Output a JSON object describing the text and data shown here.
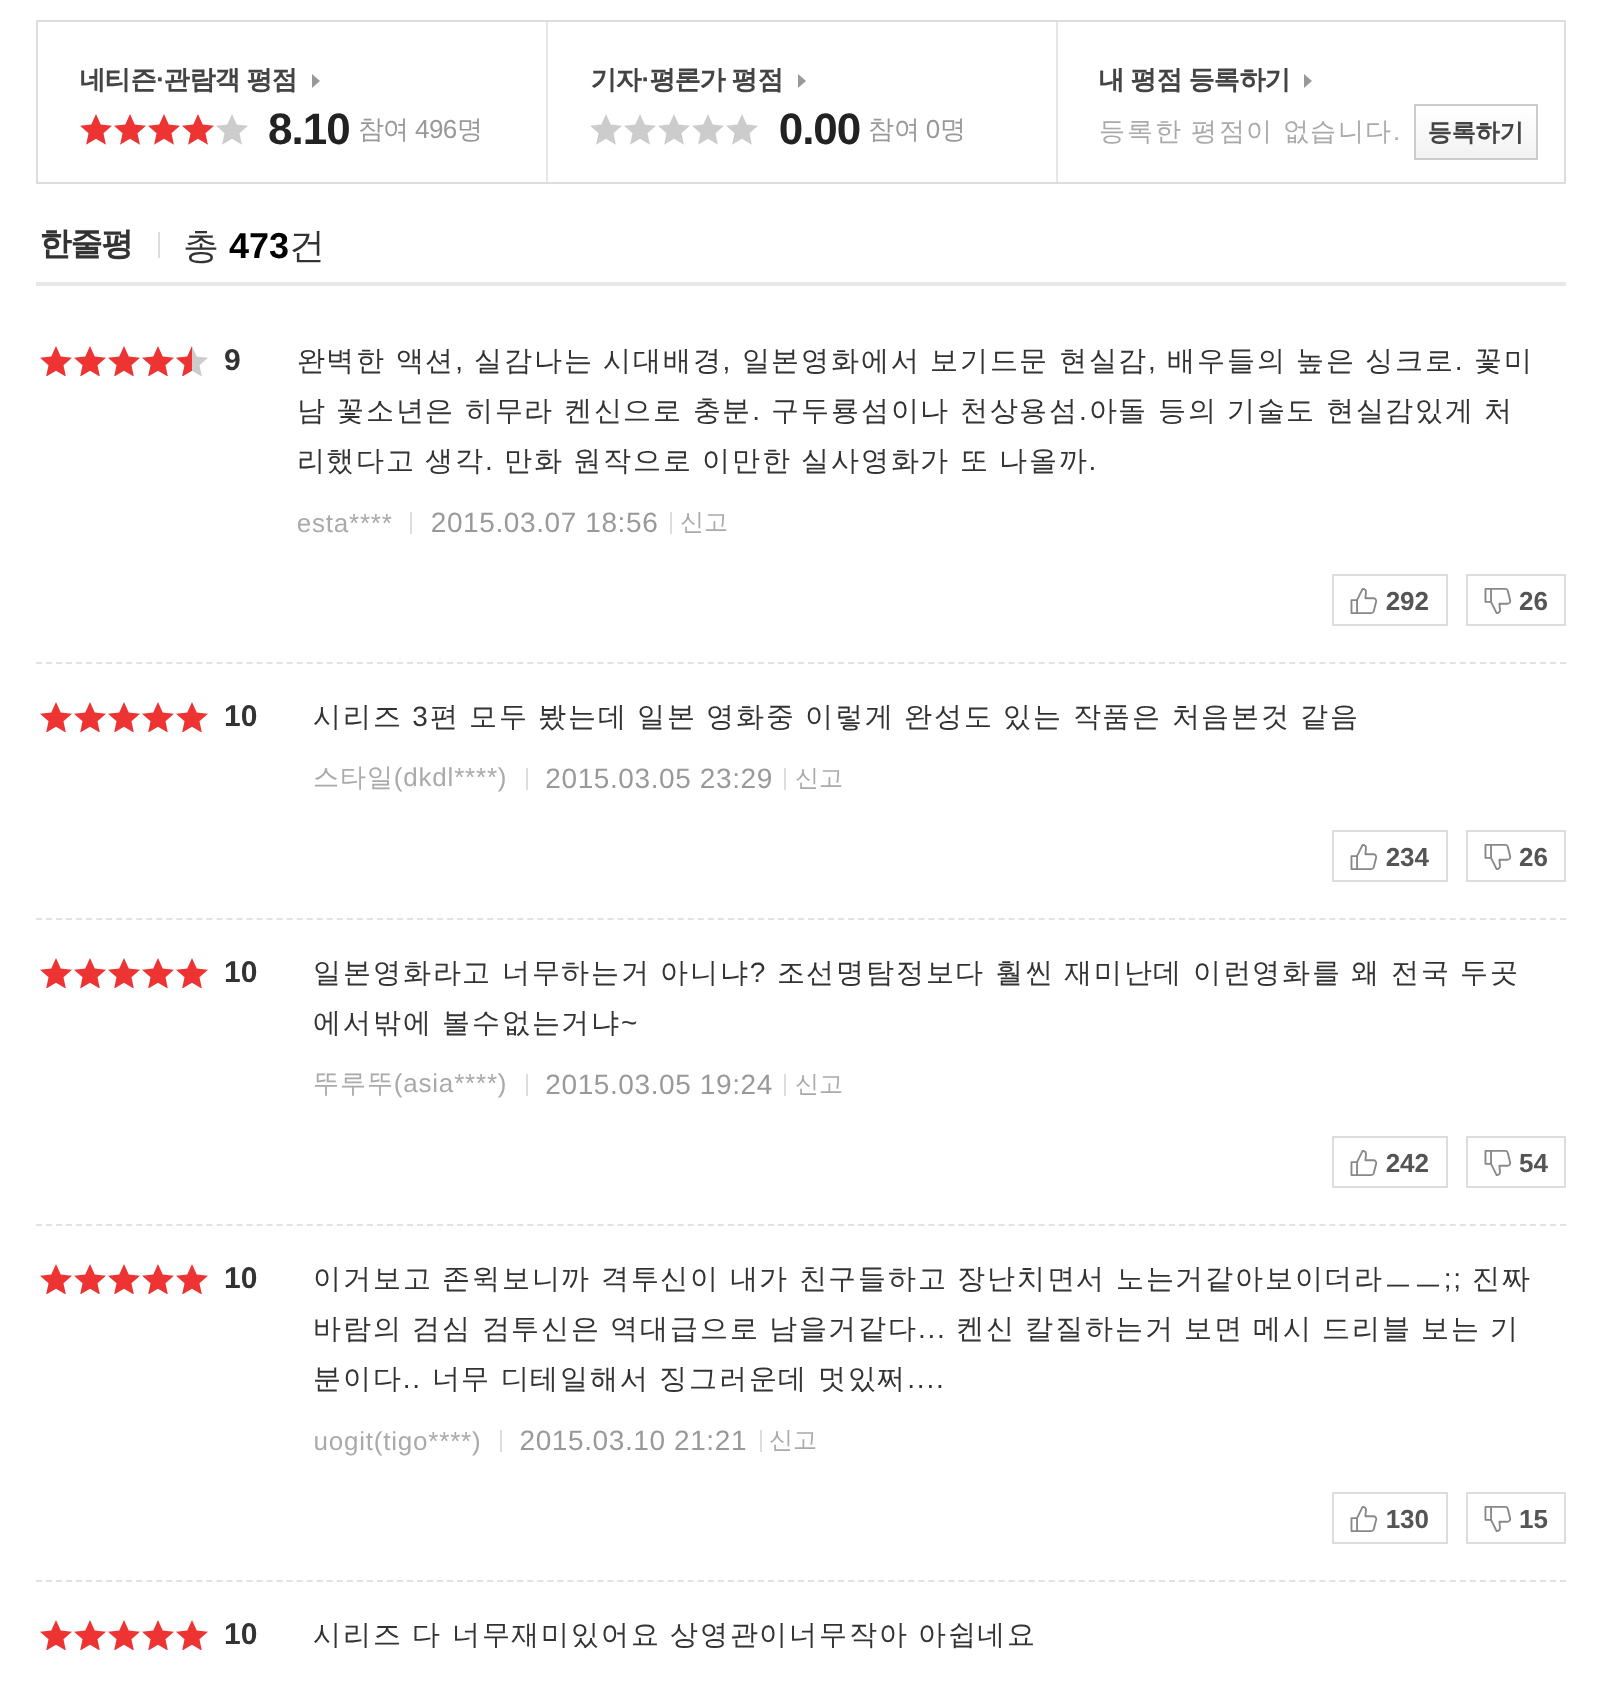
{
  "rating_panels": [
    {
      "kind": "score",
      "title": "네티즌·관람객 평점",
      "stars": 4,
      "score": "8.10",
      "participants": "참여 496명"
    },
    {
      "kind": "score",
      "title": "기자·평론가 평점",
      "stars": 0,
      "score": "0.00",
      "participants": "참여 0명"
    },
    {
      "kind": "register",
      "title": "내 평점 등록하기",
      "message": "등록한 평점이 없습니다.",
      "button": "등록하기"
    }
  ],
  "reviews_header": {
    "title": "한줄평",
    "total": "총 **473**건"
  },
  "reviews": [
    {
      "stars": 4.5,
      "score": "9",
      "text": "완벽한 액션, 실감나는 시대배경, 일본영화에서 보기드문 현실감, 배우들의 높은 싱크로. 꽃미남 꽃소년은 히무라 켄신으로 충분. 구두룡섬이나 천상용섬.아돌 등의 기술도 현실감있게 처리했다고 생각. 만화 원작으로 이만한 실사영화가 또 나올까.",
      "author": "esta****",
      "date": "2015.03.07 18:56",
      "report": "신고",
      "likes": "292",
      "dislikes": "26"
    },
    {
      "stars": 5,
      "score": "10",
      "text": "시리즈 3편 모두 봤는데 일본 영화중 이렇게 완성도 있는 작품은 처음본것 같음",
      "author": "스타일(dkdl****)",
      "date": "2015.03.05 23:29",
      "report": "신고",
      "likes": "234",
      "dislikes": "26"
    },
    {
      "stars": 5,
      "score": "10",
      "text": "일본영화라고 너무하는거 아니냐? 조선명탐정보다 훨씬 재미난데 이런영화를 왜 전국 두곳에서밖에 볼수없는거냐~",
      "author": "뚜루뚜(asia****)",
      "date": "2015.03.05 19:24",
      "report": "신고",
      "likes": "242",
      "dislikes": "54"
    },
    {
      "stars": 5,
      "score": "10",
      "text": "이거보고 존윅보니까 격투신이 내가 친구들하고 장난치면서 노는거같아보이더라ㅡㅡ;; 진짜 바람의 검심 검투신은 역대급으로 남을거같다... 켄신 칼질하는거 보면 메시 드리블 보는 기분이다.. 너무 디테일해서 징그러운데 멋있쩌....",
      "author": "uogit(tigo****)",
      "date": "2015.03.10 21:21",
      "report": "신고",
      "likes": "130",
      "dislikes": "15"
    },
    {
      "stars": 5,
      "score": "10",
      "text": "시리즈 다 너무재미있어요 상영관이너무작아 아쉽네요"
    }
  ]
}
